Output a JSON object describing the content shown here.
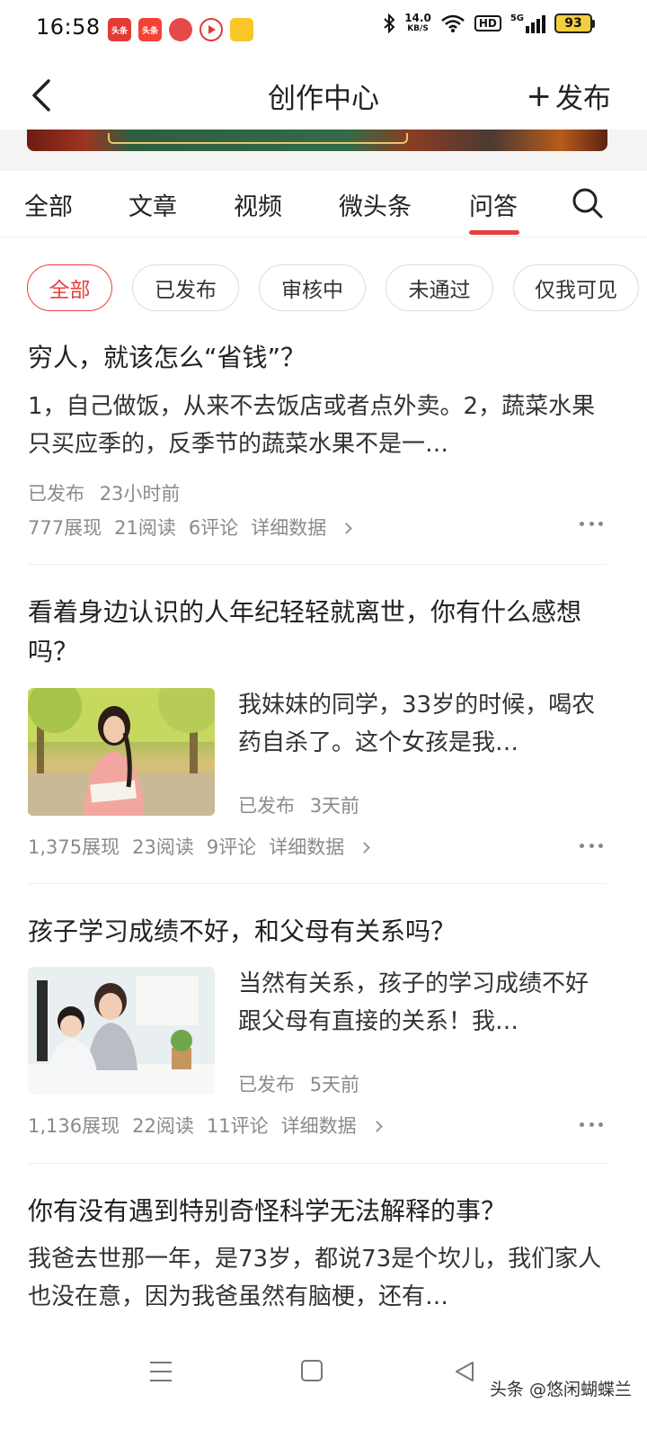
{
  "status_bar": {
    "time": "16:58",
    "app_icons": [
      "头条",
      "头条",
      "",
      "",
      ""
    ],
    "net_speed_value": "14.0",
    "net_speed_unit": "KB/S",
    "hd": "HD",
    "signal_label": "5G",
    "battery": "93"
  },
  "nav": {
    "title": "创作中心",
    "publish_label": "发布"
  },
  "tabs": [
    {
      "label": "全部",
      "active": false
    },
    {
      "label": "文章",
      "active": false
    },
    {
      "label": "视频",
      "active": false
    },
    {
      "label": "微头条",
      "active": false
    },
    {
      "label": "问答",
      "active": true
    }
  ],
  "filters": [
    {
      "label": "全部",
      "active": true
    },
    {
      "label": "已发布",
      "active": false
    },
    {
      "label": "审核中",
      "active": false
    },
    {
      "label": "未通过",
      "active": false
    },
    {
      "label": "仅我可见",
      "active": false
    }
  ],
  "items": [
    {
      "title": "穷人，就该怎么“省钱”？",
      "excerpt": "1，自己做饭，从来不去饭店或者点外卖。2，蔬菜水果只买应季的，反季节的蔬菜水果不是一…",
      "status": "已发布",
      "time": "23小时前",
      "impressions": "777展现",
      "reads": "21阅读",
      "comments": "6评论",
      "detail_label": "详细数据"
    },
    {
      "title": "看着身边认识的人年纪轻轻就离世，你有什么感想吗？",
      "excerpt": "我妹妹的同学，33岁的时候，喝农药自杀了。这个女孩是我…",
      "status": "已发布",
      "time": "3天前",
      "impressions": "1,375展现",
      "reads": "23阅读",
      "comments": "9评论",
      "detail_label": "详细数据"
    },
    {
      "title": "孩子学习成绩不好，和父母有关系吗？",
      "excerpt": "当然有关系，孩子的学习成绩不好跟父母有直接的关系！我…",
      "status": "已发布",
      "time": "5天前",
      "impressions": "1,136展现",
      "reads": "22阅读",
      "comments": "11评论",
      "detail_label": "详细数据"
    },
    {
      "title": "你有没有遇到特别奇怪科学无法解释的事？",
      "excerpt": "我爸去世那一年，是73岁，都说73是个坎儿，我们家人也没在意，因为我爸虽然有脑梗，还有…"
    }
  ],
  "watermark": "头条 @悠闲蝴蝶兰",
  "colors": {
    "accent": "#e8403c",
    "text": "#222222",
    "muted": "#8a8a8a"
  }
}
